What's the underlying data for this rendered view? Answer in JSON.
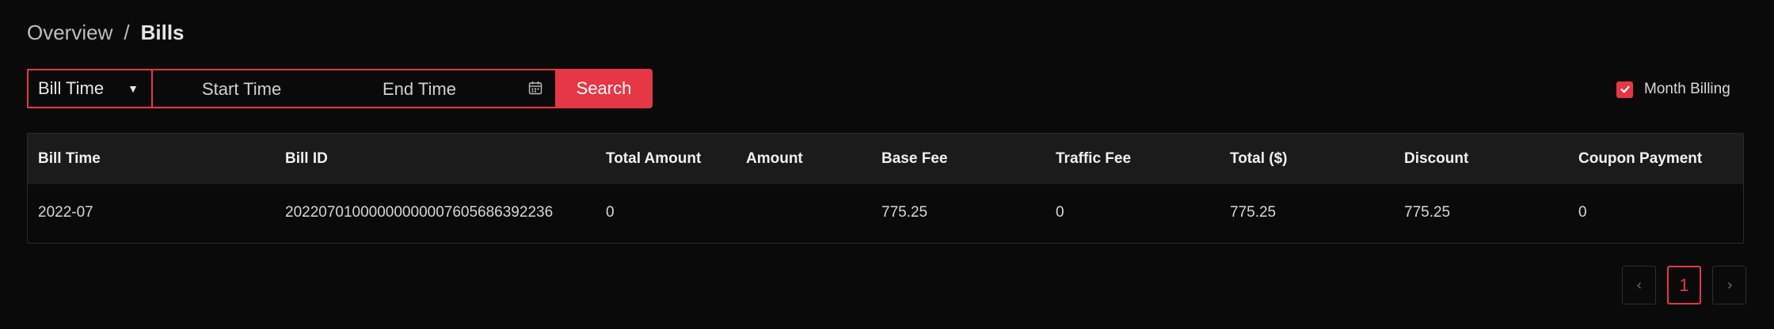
{
  "breadcrumb": {
    "parent": "Overview",
    "separator": "/",
    "current": "Bills"
  },
  "filters": {
    "type_select": "Bill Time",
    "start_placeholder": "Start Time",
    "end_placeholder": "End Time",
    "search_label": "Search",
    "month_billing_label": "Month Billing",
    "month_billing_checked": true
  },
  "table": {
    "columns": [
      "Bill Time",
      "Bill ID",
      "Total Amount",
      "Amount",
      "Base Fee",
      "Traffic Fee",
      "Total ($)",
      "Discount",
      "Coupon Payment"
    ],
    "rows": [
      [
        "2022-07",
        "20220701000000000007605686392236",
        "0",
        "",
        "775.25",
        "0",
        "775.25",
        "775.25",
        "0"
      ]
    ]
  },
  "pagination": {
    "prev_icon": "chevron-left-icon",
    "current_page": "1",
    "next_icon": "chevron-right-icon"
  },
  "colors": {
    "accent": "#e63745",
    "background": "#0a0a0a",
    "header_bg": "#1b1b1b"
  }
}
